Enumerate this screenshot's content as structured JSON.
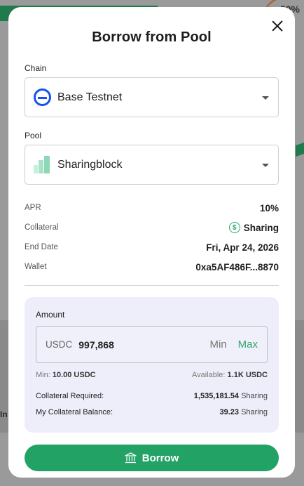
{
  "background": {
    "corner_value": "50%",
    "cut_text": "In"
  },
  "modal": {
    "title": "Borrow from Pool",
    "chain": {
      "label": "Chain",
      "value": "Base Testnet",
      "icon": "base-chain-icon"
    },
    "pool": {
      "label": "Pool",
      "value": "Sharingblock",
      "icon": "building-icon"
    },
    "details": [
      {
        "key": "APR",
        "value": "10%"
      },
      {
        "key": "Collateral",
        "value": "Sharing",
        "icon": "dollar-coin-icon"
      },
      {
        "key": "End Date",
        "value": "Fri, Apr 24, 2026"
      },
      {
        "key": "Wallet",
        "value": "0xa5AF486F...8870"
      }
    ],
    "amount": {
      "label": "Amount",
      "currency": "USDC",
      "value": "997,868",
      "min_label": "Min",
      "max_label": "Max",
      "min_text": "Min:",
      "min_value": "10.00 USDC",
      "available_text": "Available:",
      "available_value": "1.1K USDC"
    },
    "collateral_required": {
      "label": "Collateral Required:",
      "amount": "1,535,181.54",
      "unit": "Sharing"
    },
    "collateral_balance": {
      "label": "My Collateral Balance:",
      "amount": "39.23",
      "unit": "Sharing"
    },
    "borrow_label": "Borrow"
  },
  "colors": {
    "accent": "#22a265",
    "chain_blue": "#1652f0",
    "panel": "#eeeefb"
  }
}
